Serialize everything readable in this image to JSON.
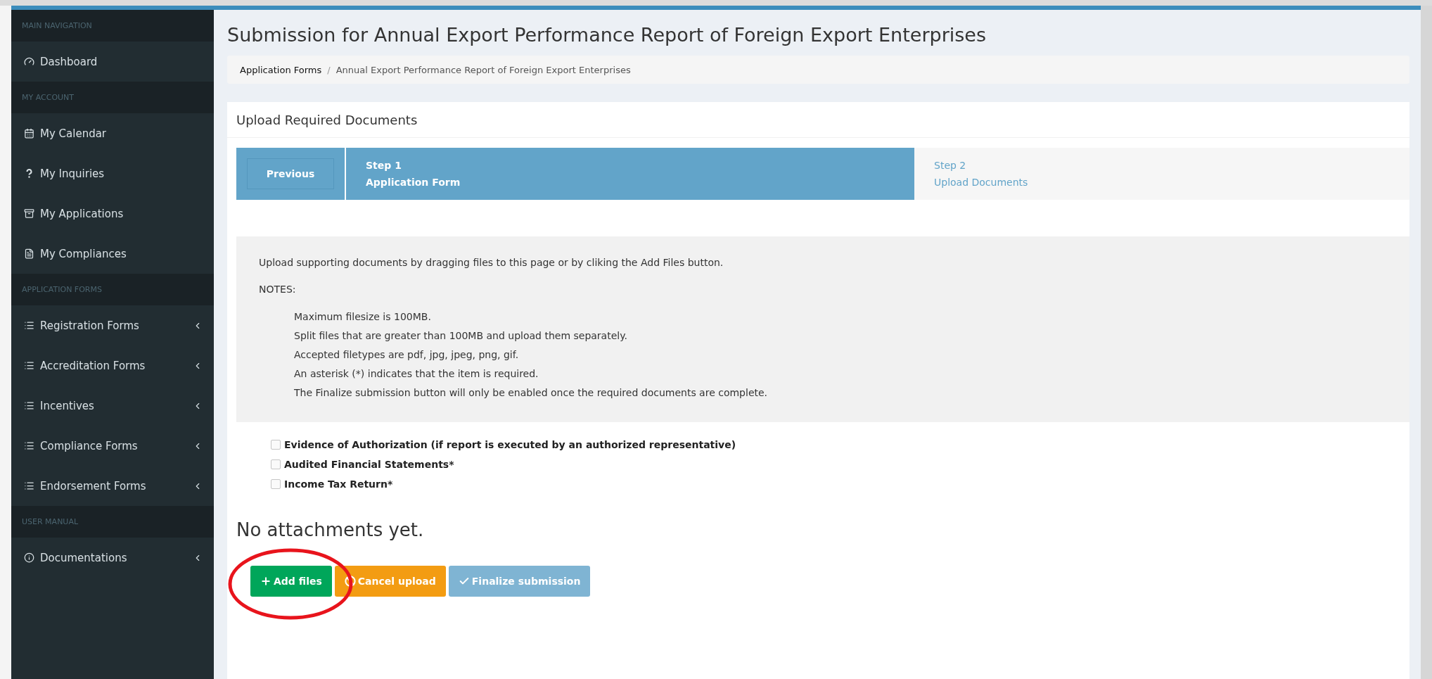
{
  "sidebar": {
    "sections": [
      {
        "header": "MAIN NAVIGATION",
        "items": [
          {
            "label": "Dashboard",
            "expandable": false
          }
        ]
      },
      {
        "header": "MY ACCOUNT",
        "items": [
          {
            "label": "My Calendar",
            "expandable": false
          },
          {
            "label": "My Inquiries",
            "expandable": false
          },
          {
            "label": "My Applications",
            "expandable": false
          },
          {
            "label": "My Compliances",
            "expandable": false
          }
        ]
      },
      {
        "header": "APPLICATION FORMS",
        "items": [
          {
            "label": "Registration Forms",
            "expandable": true
          },
          {
            "label": "Accreditation Forms",
            "expandable": true
          },
          {
            "label": "Incentives",
            "expandable": true
          },
          {
            "label": "Compliance Forms",
            "expandable": true
          },
          {
            "label": "Endorsement Forms",
            "expandable": true
          }
        ]
      },
      {
        "header": "USER MANUAL",
        "items": [
          {
            "label": "Documentations",
            "expandable": true
          }
        ]
      }
    ]
  },
  "page": {
    "title": "Submission for Annual Export Performance Report of Foreign Export Enterprises",
    "breadcrumb_separator": "/",
    "breadcrumb": [
      "Application Forms",
      "Annual Export Performance Report of Foreign Export Enterprises"
    ]
  },
  "card": {
    "title": "Upload Required Documents",
    "wizard": {
      "previous": "Previous",
      "steps": [
        {
          "step": "Step 1",
          "label": "Application Form",
          "selected": true
        },
        {
          "step": "Step 2",
          "label": "Upload Documents",
          "selected": false
        }
      ]
    },
    "intro": "Upload supporting documents by dragging files to this page or by cliking the Add Files button.",
    "notes_title": "NOTES:",
    "notes": [
      "Maximum filesize is 100MB.",
      "Split files that are greater than 100MB and upload them separately.",
      "Accepted filetypes are pdf, jpg, jpeg, png, gif.",
      "An asterisk (*) indicates that the item is required.",
      "The Finalize submission button will only be enabled once the required documents are complete."
    ],
    "documents": [
      {
        "label": "Evidence of Authorization (if report is executed by an authorized representative)",
        "checked": false
      },
      {
        "label": "Audited Financial Statements*",
        "checked": false
      },
      {
        "label": "Income Tax Return*",
        "checked": false
      }
    ],
    "empty_message": "No attachments yet.",
    "buttons": [
      {
        "kind": "add",
        "label": "Add files",
        "disabled": false
      },
      {
        "kind": "cancel",
        "label": "Cancel upload",
        "disabled": false
      },
      {
        "kind": "finalize",
        "label": "Finalize submission",
        "disabled": true
      }
    ]
  }
}
